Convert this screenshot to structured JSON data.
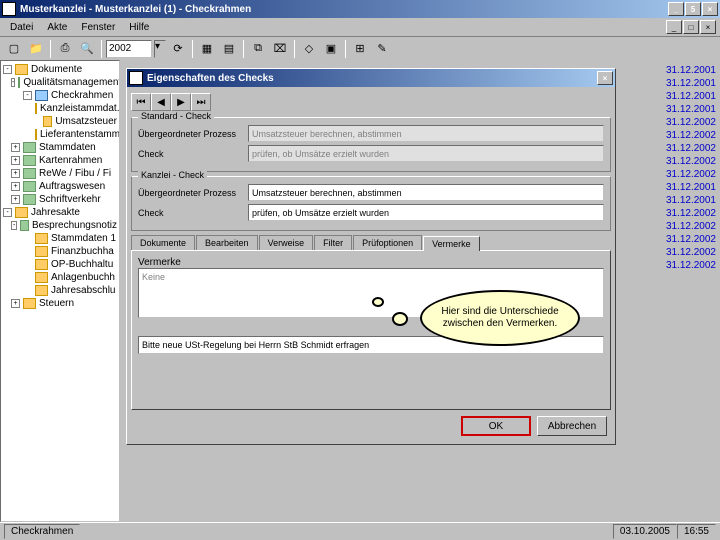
{
  "app": {
    "title": "Musterkanzlei - Musterkanzlei (1) - Checkrahmen",
    "menus": [
      "Datei",
      "Akte",
      "Fenster",
      "Hilfe"
    ],
    "year": "2002"
  },
  "tree": {
    "root": "Dokumente",
    "items": [
      {
        "ind": 1,
        "tog": "-",
        "label": "Qualitätsmanagement",
        "cls": "gr"
      },
      {
        "ind": 2,
        "tog": "-",
        "label": "Checkrahmen",
        "cls": "bl"
      },
      {
        "ind": 3,
        "tog": "",
        "label": "Kanzleistammdat.",
        "cls": ""
      },
      {
        "ind": 3,
        "tog": "",
        "label": "Umsatzsteuer",
        "cls": ""
      },
      {
        "ind": 3,
        "tog": "",
        "label": "Lieferantenstamm",
        "cls": ""
      },
      {
        "ind": 1,
        "tog": "+",
        "label": "Stammdaten",
        "cls": "gr"
      },
      {
        "ind": 1,
        "tog": "+",
        "label": "Kartenrahmen",
        "cls": "gr"
      },
      {
        "ind": 1,
        "tog": "+",
        "label": "ReWe / Fibu / Fi",
        "cls": "gr"
      },
      {
        "ind": 1,
        "tog": "+",
        "label": "Auftragswesen",
        "cls": "gr"
      },
      {
        "ind": 1,
        "tog": "+",
        "label": "Schriftverkehr",
        "cls": "gr"
      },
      {
        "ind": 0,
        "tog": "-",
        "label": "Jahresakte",
        "cls": ""
      },
      {
        "ind": 1,
        "tog": "-",
        "label": "Besprechungsnotiz",
        "cls": "gr"
      },
      {
        "ind": 2,
        "tog": "",
        "label": "Stammdaten 1",
        "cls": ""
      },
      {
        "ind": 2,
        "tog": "",
        "label": "Finanzbuchha",
        "cls": ""
      },
      {
        "ind": 2,
        "tog": "",
        "label": "OP-Buchhaltu",
        "cls": ""
      },
      {
        "ind": 2,
        "tog": "",
        "label": "Anlagenbuchh",
        "cls": ""
      },
      {
        "ind": 2,
        "tog": "",
        "label": "Jahresabschlu",
        "cls": ""
      },
      {
        "ind": 1,
        "tog": "+",
        "label": "Steuern",
        "cls": ""
      }
    ]
  },
  "dates": [
    "31.12.2001",
    "31.12.2001",
    "31.12.2001",
    "31.12.2001",
    "31.12.2002",
    "31.12.2002",
    "31.12.2002",
    "31.12.2002",
    "31.12.2002",
    "31.12.2001",
    "31.12.2001",
    "31.12.2002",
    "31.12.2002",
    "31.12.2002",
    "31.12.2002",
    "31.12.2002"
  ],
  "dialog": {
    "title": "Eigenschaften des Checks",
    "group1": {
      "label": "Standard - Check",
      "f1_label": "Übergeordneter Prozess",
      "f1_value": "Umsatzsteuer berechnen, abstimmen",
      "f2_label": "Check",
      "f2_value": "prüfen, ob Umsätze erzielt wurden"
    },
    "group2": {
      "label": "Kanzlei - Check",
      "f1_label": "Übergeordneter Prozess",
      "f1_value": "Umsatzsteuer berechnen, abstimmen",
      "f2_label": "Check",
      "f2_value": "prüfen, ob Umsätze erzielt wurden"
    },
    "tabs": [
      "Dokumente",
      "Bearbeiten",
      "Verweise",
      "Filter",
      "Prüfoptionen",
      "Vermerke"
    ],
    "vermerke_label": "Vermerke",
    "vermerke_placeholder": "Keine",
    "vermerke_text": "Bitte neue USt-Regelung bei Herrn StB Schmidt erfragen",
    "ok": "OK",
    "cancel": "Abbrechen"
  },
  "callout": "Hier sind die Unterschiede zwischen den Vermerken.",
  "status": {
    "left": "Checkrahmen",
    "date": "03.10.2005",
    "time": "16:55"
  }
}
